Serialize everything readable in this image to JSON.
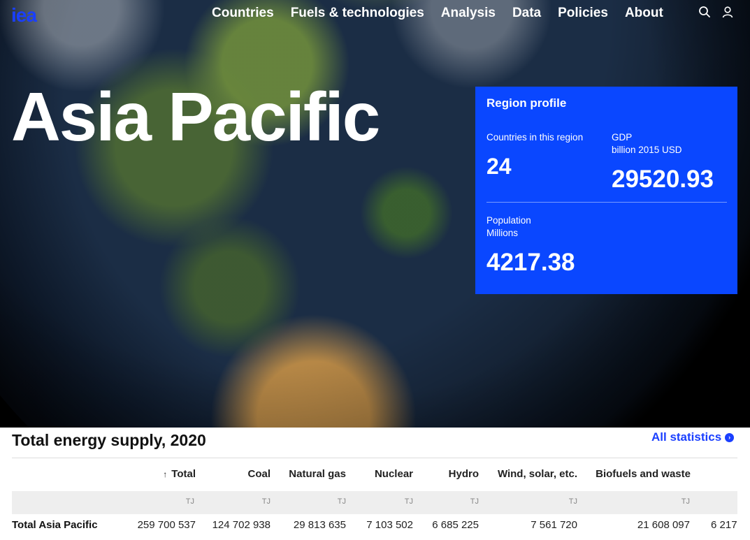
{
  "nav": {
    "logo": "iea",
    "items": [
      "Countries",
      "Fuels & technologies",
      "Analysis",
      "Data",
      "Policies",
      "About"
    ],
    "icons": [
      "search-icon",
      "user-icon"
    ]
  },
  "hero": {
    "title": "Asia Pacific"
  },
  "profile": {
    "title": "Region profile",
    "countries_label": "Countries in this region",
    "countries_value": "24",
    "gdp_label": "GDP",
    "gdp_unit": "billion 2015 USD",
    "gdp_value": "29520.93",
    "population_label": "Population",
    "population_unit": "Millions",
    "population_value": "4217.38"
  },
  "energy": {
    "title": "Total energy supply, 2020",
    "link": "All statistics",
    "sort_arrow": "↑",
    "columns": [
      "Total",
      "Coal",
      "Natural gas",
      "Nuclear",
      "Hydro",
      "Wind, solar, etc.",
      "Biofuels and waste"
    ],
    "unit": "TJ",
    "row_label": "Total Asia Pacific",
    "row_values": [
      "259 700 537",
      "124 702 938",
      "29 813 635",
      "7 103 502",
      "6 685 225",
      "7 561 720",
      "21 608 097",
      "6 217"
    ]
  },
  "colors": {
    "brand_blue": "#0a47ff",
    "link_blue": "#1a3fff"
  }
}
